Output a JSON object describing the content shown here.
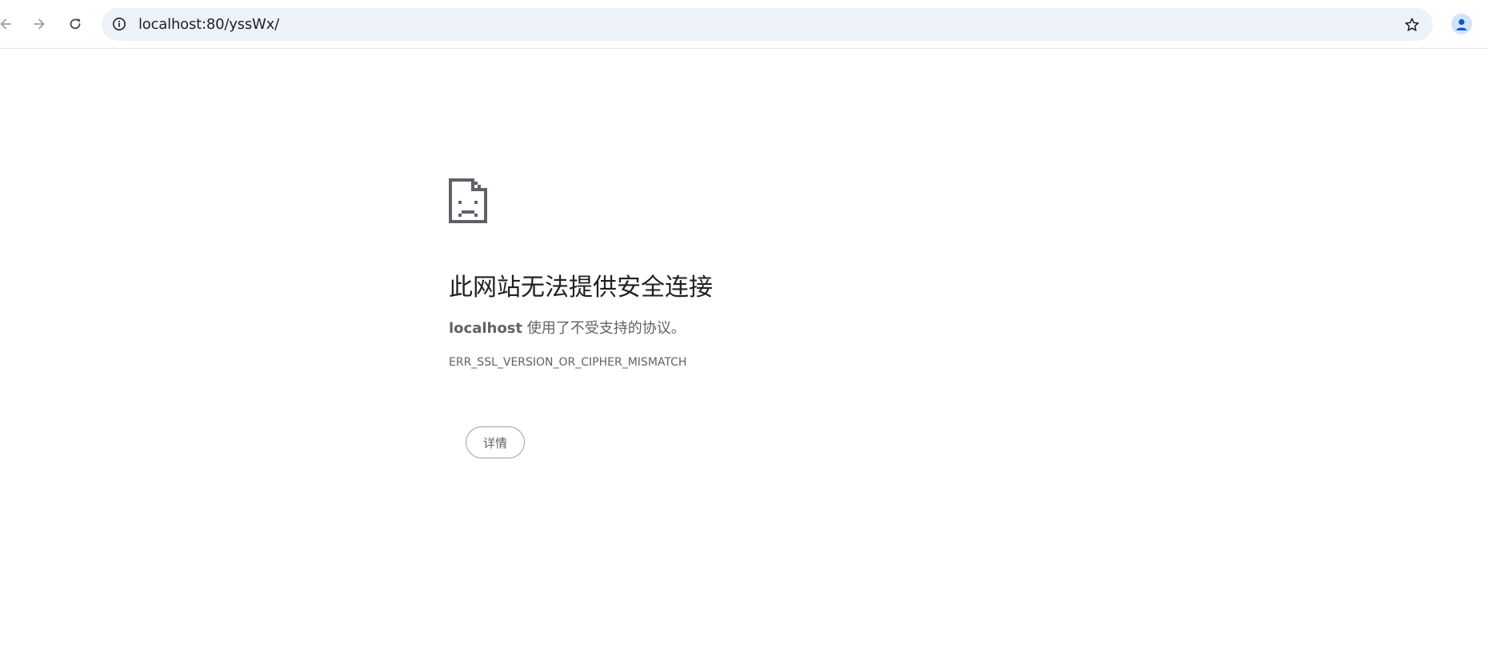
{
  "browser": {
    "url": "localhost:80/yssWx/",
    "icons": {
      "back": "arrow-left-icon",
      "forward": "arrow-right-icon",
      "reload": "reload-icon",
      "site_info": "info-icon",
      "bookmark": "star-icon",
      "profile": "person-icon"
    }
  },
  "error_page": {
    "icon": "sad-document-icon",
    "title": "此网站无法提供安全连接",
    "host": "localhost",
    "description": " 使用了不受支持的协议。",
    "code": "ERR_SSL_VERSION_OR_CIPHER_MISMATCH",
    "details_button": "详情"
  },
  "colors": {
    "omnibox_bg": "#edf2fa",
    "title_text": "#202124",
    "secondary_text": "#5f6368",
    "accent": "#0b57d0"
  }
}
